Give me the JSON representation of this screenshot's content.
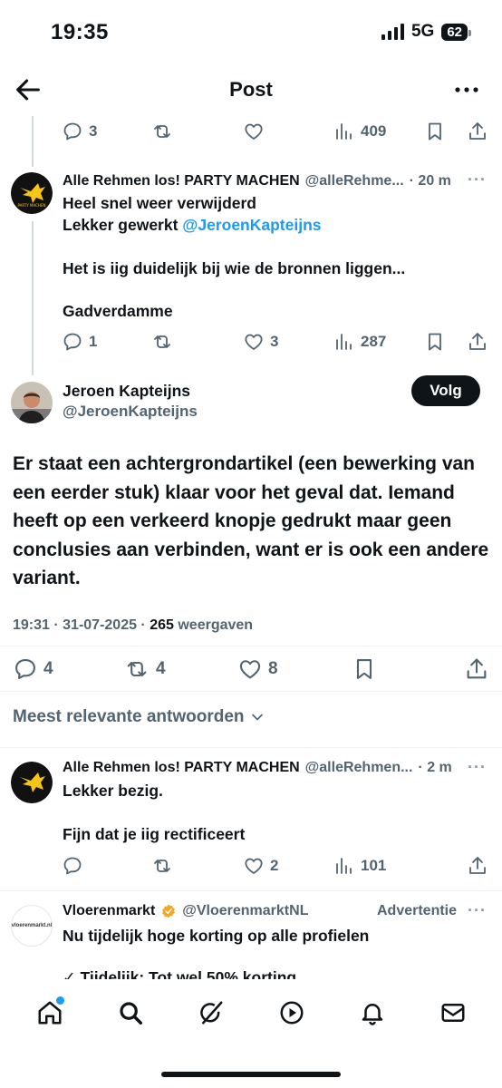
{
  "status": {
    "time": "19:35",
    "network": "5G",
    "battery": "62"
  },
  "header": {
    "title": "Post"
  },
  "top_actions": {
    "replies": "3",
    "reposts": "",
    "likes": "",
    "views": "409"
  },
  "reply1": {
    "name": "Alle Rehmen los! PARTY MACHEN",
    "handle": "@alleRehme...",
    "time": "· 20 m",
    "line1": "Heel snel weer verwijderd",
    "line2_prefix": "Lekker gewerkt ",
    "mention": "@JeroenKapteijns",
    "line3": "Het is iig duidelijk bij wie de bronnen liggen...",
    "line4": "Gadverdamme",
    "replies": "1",
    "likes": "3",
    "views": "287"
  },
  "main": {
    "name": "Jeroen Kapteijns",
    "handle": "@JeroenKapteijns",
    "follow_label": "Volg",
    "text": "Er staat een achtergrondartikel (een bewerking van een eerder stuk) klaar voor het geval dat. Iemand heeft op een verkeerd knopje gedrukt maar geen conclusies aan verbinden, want er is ook een andere variant.",
    "time": "19:31 · 31-07-2025 · ",
    "views_count": "265",
    "views_label": " weergaven",
    "replies": "4",
    "reposts": "4",
    "likes": "8"
  },
  "sort_label": "Meest relevante antwoorden",
  "reply2": {
    "name": "Alle Rehmen los! PARTY MACHEN",
    "handle": "@alleRehmen...",
    "time": "· 2 m",
    "line1": "Lekker bezig.",
    "line2": "Fijn dat je iig rectificeert",
    "replies": "",
    "likes": "2",
    "views": "101"
  },
  "ad": {
    "name": "Vloerenmarkt",
    "handle": "@VloerenmarktNL",
    "label": "Advertentie",
    "line1": "Nu tijdelijk hoge korting op alle profielen",
    "line2": "✓ Tijdelijk: Tot wel 50% korting",
    "logo_text": "vloerenmarkt.nl"
  },
  "avatar_text": "PARTY MACHEN",
  "colors": {
    "accent": "#1d9bf0",
    "text": "#0f1419",
    "muted": "#536471"
  },
  "icons": [
    "back-icon",
    "more-icon",
    "reply-icon",
    "repost-icon",
    "like-icon",
    "views-icon",
    "bookmark-icon",
    "share-icon",
    "home-icon",
    "search-icon",
    "grok-icon",
    "video-icon",
    "bell-icon",
    "mail-icon",
    "verified-icon",
    "chevron-down-icon"
  ]
}
